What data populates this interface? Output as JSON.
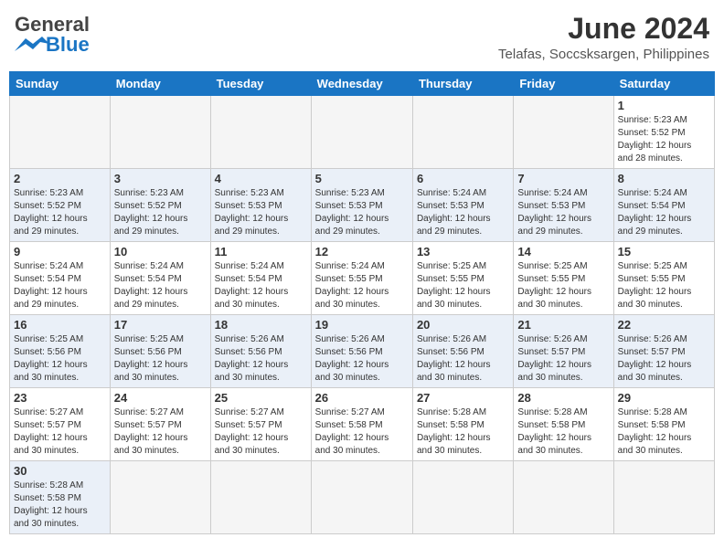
{
  "header": {
    "logo_general": "General",
    "logo_blue": "Blue",
    "title": "June 2024",
    "subtitle": "Telafas, Soccsksargen, Philippines"
  },
  "weekdays": [
    "Sunday",
    "Monday",
    "Tuesday",
    "Wednesday",
    "Thursday",
    "Friday",
    "Saturday"
  ],
  "weeks": [
    {
      "alt": false,
      "days": [
        {
          "num": "",
          "empty": true
        },
        {
          "num": "",
          "empty": true
        },
        {
          "num": "",
          "empty": true
        },
        {
          "num": "",
          "empty": true
        },
        {
          "num": "",
          "empty": true
        },
        {
          "num": "",
          "empty": true
        },
        {
          "num": "1",
          "sunrise": "5:23 AM",
          "sunset": "5:52 PM",
          "daylight": "12 hours and 28 minutes."
        }
      ]
    },
    {
      "alt": true,
      "days": [
        {
          "num": "2",
          "sunrise": "5:23 AM",
          "sunset": "5:52 PM",
          "daylight": "12 hours and 29 minutes."
        },
        {
          "num": "3",
          "sunrise": "5:23 AM",
          "sunset": "5:52 PM",
          "daylight": "12 hours and 29 minutes."
        },
        {
          "num": "4",
          "sunrise": "5:23 AM",
          "sunset": "5:53 PM",
          "daylight": "12 hours and 29 minutes."
        },
        {
          "num": "5",
          "sunrise": "5:23 AM",
          "sunset": "5:53 PM",
          "daylight": "12 hours and 29 minutes."
        },
        {
          "num": "6",
          "sunrise": "5:24 AM",
          "sunset": "5:53 PM",
          "daylight": "12 hours and 29 minutes."
        },
        {
          "num": "7",
          "sunrise": "5:24 AM",
          "sunset": "5:53 PM",
          "daylight": "12 hours and 29 minutes."
        },
        {
          "num": "8",
          "sunrise": "5:24 AM",
          "sunset": "5:54 PM",
          "daylight": "12 hours and 29 minutes."
        }
      ]
    },
    {
      "alt": false,
      "days": [
        {
          "num": "9",
          "sunrise": "5:24 AM",
          "sunset": "5:54 PM",
          "daylight": "12 hours and 29 minutes."
        },
        {
          "num": "10",
          "sunrise": "5:24 AM",
          "sunset": "5:54 PM",
          "daylight": "12 hours and 29 minutes."
        },
        {
          "num": "11",
          "sunrise": "5:24 AM",
          "sunset": "5:54 PM",
          "daylight": "12 hours and 30 minutes."
        },
        {
          "num": "12",
          "sunrise": "5:24 AM",
          "sunset": "5:55 PM",
          "daylight": "12 hours and 30 minutes."
        },
        {
          "num": "13",
          "sunrise": "5:25 AM",
          "sunset": "5:55 PM",
          "daylight": "12 hours and 30 minutes."
        },
        {
          "num": "14",
          "sunrise": "5:25 AM",
          "sunset": "5:55 PM",
          "daylight": "12 hours and 30 minutes."
        },
        {
          "num": "15",
          "sunrise": "5:25 AM",
          "sunset": "5:55 PM",
          "daylight": "12 hours and 30 minutes."
        }
      ]
    },
    {
      "alt": true,
      "days": [
        {
          "num": "16",
          "sunrise": "5:25 AM",
          "sunset": "5:56 PM",
          "daylight": "12 hours and 30 minutes."
        },
        {
          "num": "17",
          "sunrise": "5:25 AM",
          "sunset": "5:56 PM",
          "daylight": "12 hours and 30 minutes."
        },
        {
          "num": "18",
          "sunrise": "5:26 AM",
          "sunset": "5:56 PM",
          "daylight": "12 hours and 30 minutes."
        },
        {
          "num": "19",
          "sunrise": "5:26 AM",
          "sunset": "5:56 PM",
          "daylight": "12 hours and 30 minutes."
        },
        {
          "num": "20",
          "sunrise": "5:26 AM",
          "sunset": "5:56 PM",
          "daylight": "12 hours and 30 minutes."
        },
        {
          "num": "21",
          "sunrise": "5:26 AM",
          "sunset": "5:57 PM",
          "daylight": "12 hours and 30 minutes."
        },
        {
          "num": "22",
          "sunrise": "5:26 AM",
          "sunset": "5:57 PM",
          "daylight": "12 hours and 30 minutes."
        }
      ]
    },
    {
      "alt": false,
      "days": [
        {
          "num": "23",
          "sunrise": "5:27 AM",
          "sunset": "5:57 PM",
          "daylight": "12 hours and 30 minutes."
        },
        {
          "num": "24",
          "sunrise": "5:27 AM",
          "sunset": "5:57 PM",
          "daylight": "12 hours and 30 minutes."
        },
        {
          "num": "25",
          "sunrise": "5:27 AM",
          "sunset": "5:57 PM",
          "daylight": "12 hours and 30 minutes."
        },
        {
          "num": "26",
          "sunrise": "5:27 AM",
          "sunset": "5:58 PM",
          "daylight": "12 hours and 30 minutes."
        },
        {
          "num": "27",
          "sunrise": "5:28 AM",
          "sunset": "5:58 PM",
          "daylight": "12 hours and 30 minutes."
        },
        {
          "num": "28",
          "sunrise": "5:28 AM",
          "sunset": "5:58 PM",
          "daylight": "12 hours and 30 minutes."
        },
        {
          "num": "29",
          "sunrise": "5:28 AM",
          "sunset": "5:58 PM",
          "daylight": "12 hours and 30 minutes."
        }
      ]
    },
    {
      "alt": true,
      "days": [
        {
          "num": "30",
          "sunrise": "5:28 AM",
          "sunset": "5:58 PM",
          "daylight": "12 hours and 30 minutes."
        },
        {
          "num": "",
          "empty": true
        },
        {
          "num": "",
          "empty": true
        },
        {
          "num": "",
          "empty": true
        },
        {
          "num": "",
          "empty": true
        },
        {
          "num": "",
          "empty": true
        },
        {
          "num": "",
          "empty": true
        }
      ]
    }
  ],
  "labels": {
    "sunrise": "Sunrise:",
    "sunset": "Sunset:",
    "daylight": "Daylight:"
  }
}
